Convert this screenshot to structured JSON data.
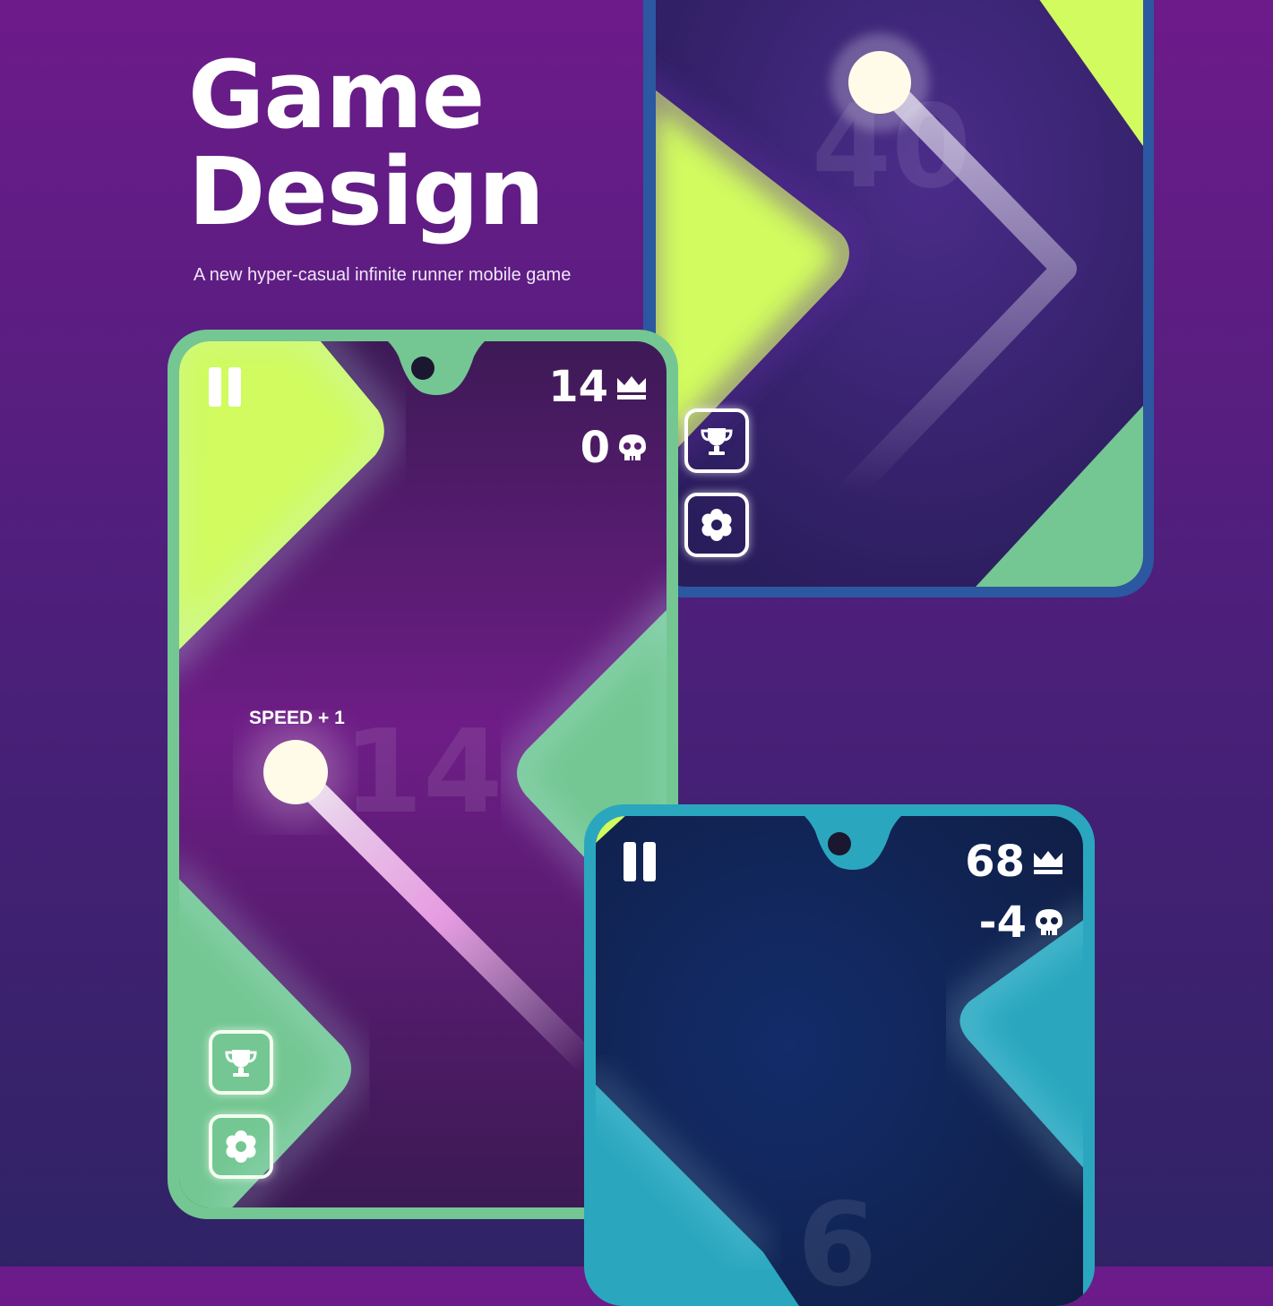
{
  "header": {
    "title_line1": "Game",
    "title_line2": "Design",
    "subtitle": "A new hyper-casual infinite runner mobile game"
  },
  "phone_top_right": {
    "bg_number": "40"
  },
  "phone_center": {
    "best_score": "14",
    "deaths": "0",
    "bg_number": "14",
    "speed_label": "SPEED + 1"
  },
  "phone_bottom_right": {
    "best_score": "68",
    "deaths": "-4",
    "bg_number": "6"
  },
  "icons": [
    "pause-icon",
    "crown-icon",
    "skull-icon",
    "trophy-icon",
    "gear-icon"
  ],
  "colors": {
    "lime": "#d1fb5f",
    "mint": "#74c792",
    "teal": "#2aa7bf",
    "purple": "#6b1d86",
    "navy": "#102257",
    "frame_green": "#74c792",
    "frame_blue": "#2b58a0",
    "frame_teal": "#2aa7bf"
  }
}
